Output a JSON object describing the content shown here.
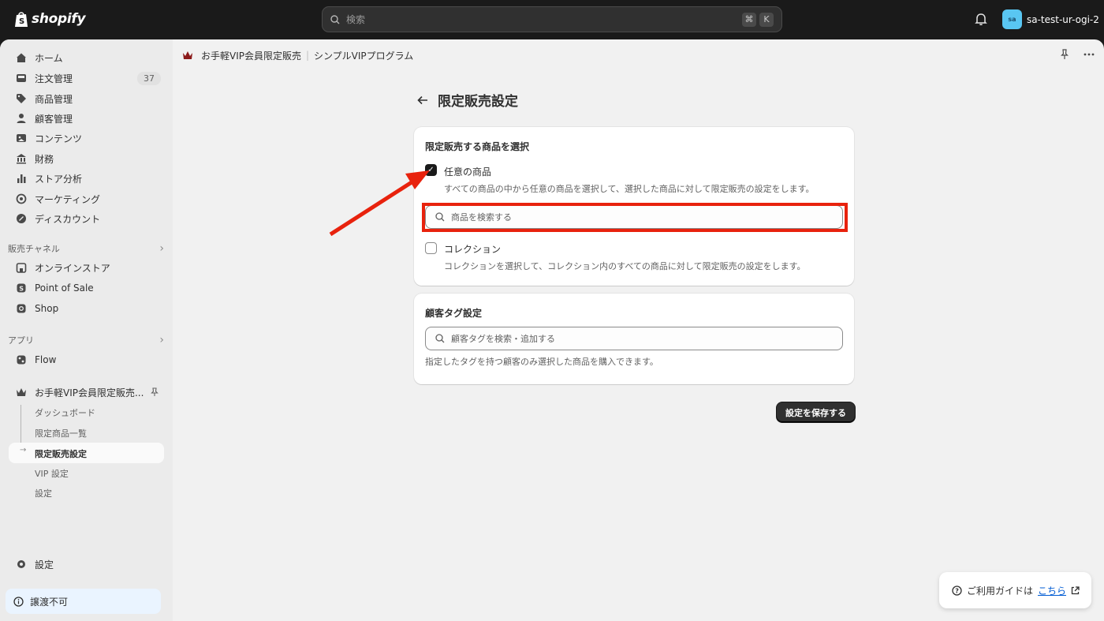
{
  "topbar": {
    "logo_text": "shopify",
    "search_placeholder": "検索",
    "shortcut_keys": [
      "⌘",
      "K"
    ],
    "store_avatar": "sa",
    "store_name": "sa-test-ur-ogi-2"
  },
  "sidebar": {
    "items": [
      {
        "label": "ホーム",
        "icon": "home-icon"
      },
      {
        "label": "注文管理",
        "icon": "inbox-icon",
        "badge": "37"
      },
      {
        "label": "商品管理",
        "icon": "tag-icon"
      },
      {
        "label": "顧客管理",
        "icon": "person-icon"
      },
      {
        "label": "コンテンツ",
        "icon": "image-icon"
      },
      {
        "label": "財務",
        "icon": "bank-icon"
      },
      {
        "label": "ストア分析",
        "icon": "chart-icon"
      },
      {
        "label": "マーケティング",
        "icon": "target-icon"
      },
      {
        "label": "ディスカウント",
        "icon": "discount-icon"
      }
    ],
    "sales_channels_label": "販売チャネル",
    "channels": [
      {
        "label": "オンラインストア",
        "icon": "store-icon"
      },
      {
        "label": "Point of Sale",
        "icon": "pos-icon"
      },
      {
        "label": "Shop",
        "icon": "shop-icon"
      }
    ],
    "apps_label": "アプリ",
    "apps": [
      {
        "label": "Flow",
        "icon": "flow-icon"
      }
    ],
    "app_name": "お手軽VIP会員限定販売...",
    "app_sub_items": [
      "ダッシュボード",
      "限定商品一覧",
      "限定販売設定",
      "VIP 設定",
      "設定"
    ],
    "settings_label": "設定",
    "non_transferable_label": "譲渡不可"
  },
  "appbar": {
    "app_title": "お手軽VIP会員限定販売",
    "plan_name": "シンプルVIPプログラム"
  },
  "page": {
    "title": "限定販売設定",
    "product_card": {
      "title": "限定販売する商品を選択",
      "option_any": {
        "label": "任意の商品",
        "checked": true,
        "help": "すべての商品の中から任意の商品を選択して、選択した商品に対して限定販売の設定をします。"
      },
      "search_placeholder": "商品を検索する",
      "option_collection": {
        "label": "コレクション",
        "checked": false,
        "help": "コレクションを選択して、コレクション内のすべての商品に対して限定販売の設定をします。"
      }
    },
    "tag_card": {
      "title": "顧客タグ設定",
      "search_placeholder": "顧客タグを検索・追加する",
      "help": "指定したタグを持つ顧客のみ選択した商品を購入できます。"
    },
    "save_label": "設定を保存する",
    "guide_text": "ご利用ガイドは",
    "guide_link": "こちら"
  },
  "annotation_color": "#e8220d"
}
